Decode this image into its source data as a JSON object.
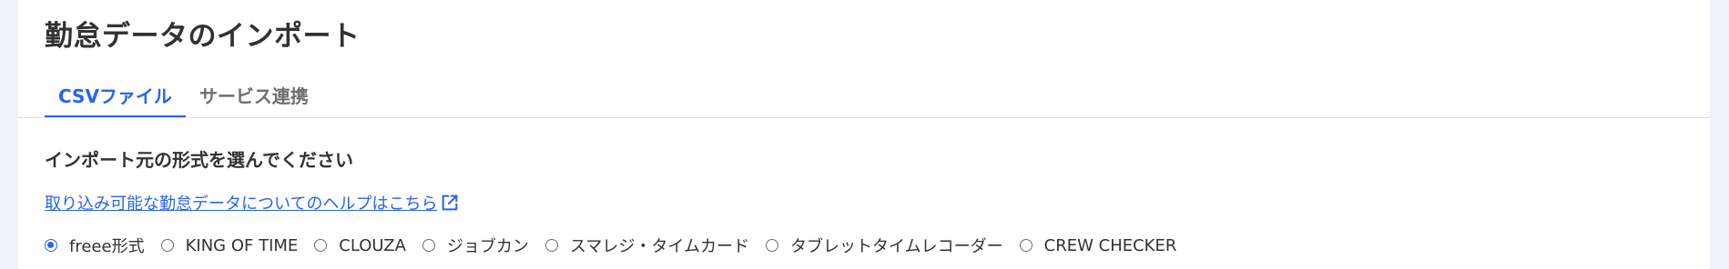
{
  "page": {
    "title": "勤怠データのインポート"
  },
  "tabs": [
    {
      "label": "CSVファイル",
      "active": true
    },
    {
      "label": "サービス連携",
      "active": false
    }
  ],
  "section": {
    "heading": "インポート元の形式を選んでください",
    "help_link": "取り込み可能な勤怠データについてのヘルプはこちら",
    "help_link_icon": "external-link-icon"
  },
  "formats": {
    "selected": "freee形式",
    "options": [
      "freee形式",
      "KING OF TIME",
      "CLOUZA",
      "ジョブカン",
      "スマレジ・タイムカード",
      "タブレットタイムレコーダー",
      "CREW CHECKER"
    ]
  },
  "colors": {
    "accent": "#2864f0",
    "text": "#323232",
    "muted": "#6e6e6e",
    "background": "#eef2fb"
  }
}
